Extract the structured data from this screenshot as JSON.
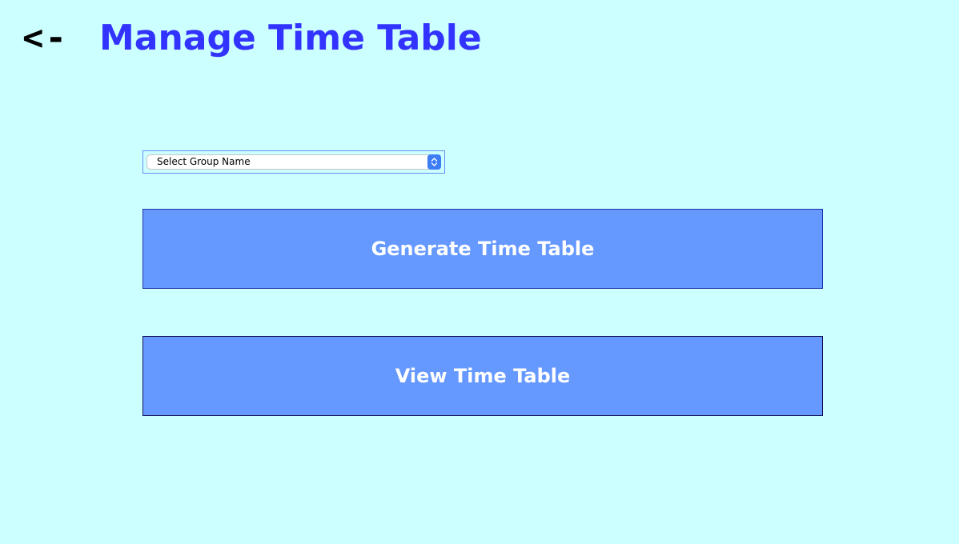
{
  "header": {
    "back_label": "<-",
    "title": "Manage Time Table"
  },
  "group_select": {
    "selected": "Select Group Name",
    "icon": "chevron-up-down-icon"
  },
  "buttons": {
    "generate_label": "Generate Time Table",
    "view_label": "View Time Table"
  },
  "colors": {
    "background": "#ccffff",
    "title": "#3333ff",
    "button_fill": "#6699ff",
    "button_text": "#ffffff",
    "select_accent": "#3d7cf4"
  }
}
